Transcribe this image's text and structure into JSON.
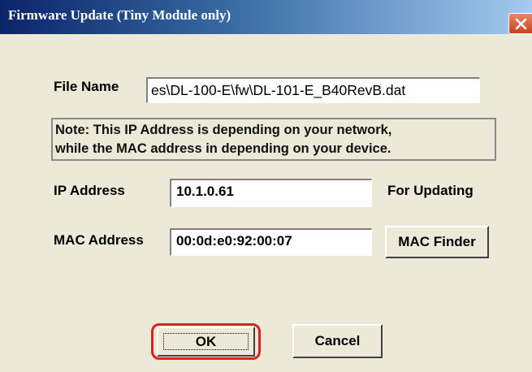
{
  "window": {
    "title": "Firmware Update (Tiny Module only)"
  },
  "file": {
    "label": "File Name",
    "value": "es\\DL-100-E\\fw\\DL-101-E_B40RevB.dat"
  },
  "note": {
    "line1": "Note: This IP Address is depending on your network,",
    "line2": "while the  MAC address in depending on your device."
  },
  "ip": {
    "label": "IP Address",
    "value": "10.1.0.61",
    "hint": "For Updating"
  },
  "mac": {
    "label": "MAC Address",
    "value": "00:0d:e0:92:00:07",
    "finder_label": "MAC Finder"
  },
  "buttons": {
    "ok_label": "OK",
    "cancel_label": "Cancel"
  },
  "colors": {
    "titlebar_start": "#0a246a",
    "titlebar_end": "#a6caf0",
    "dialog_bg": "#ece9d8",
    "highlight": "#e0201e",
    "close_button": "#c8421a"
  }
}
